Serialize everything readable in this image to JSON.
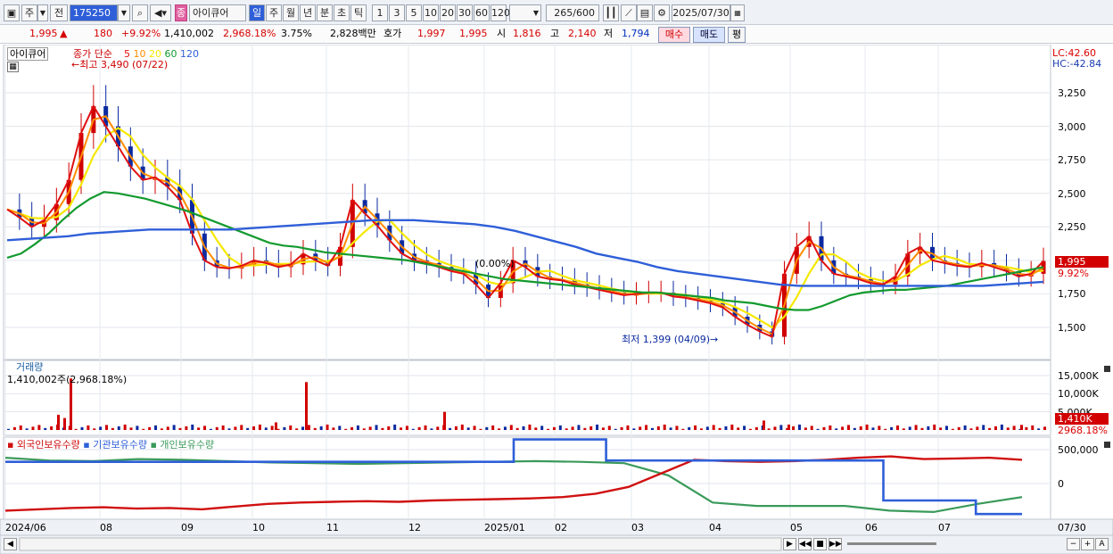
{
  "toolbar": {
    "window_icon": "window-icon",
    "market_select": "주",
    "prev_label": "전",
    "code": "175250",
    "name_badge": "종",
    "stock_name": "아이큐어",
    "periods": [
      "일",
      "주",
      "월",
      "년",
      "분",
      "초",
      "틱"
    ],
    "active_period": "일",
    "intervals": [
      "1",
      "3",
      "5",
      "10",
      "20",
      "30",
      "60",
      "120"
    ],
    "count": "265",
    "count_max": "/600",
    "date": "2025/07/30"
  },
  "quote": {
    "price": "1,995",
    "arrow": "▲",
    "change": "180",
    "change_pct": "+9.92%",
    "volume": "1,410,002",
    "volume_ratio": "2,968.18%",
    "turnover": "3.75%",
    "amount": "2,828백만",
    "hoga_label": "호가",
    "ask": "1,997",
    "bid": "1,995",
    "open_label": "시",
    "open": "1,816",
    "high_label": "고",
    "high": "2,140",
    "low_label": "저",
    "low": "1,794",
    "buy_label": "매수",
    "sell_label": "매도",
    "eval_label": "평"
  },
  "main_panel": {
    "stock_tag": "아이큐어",
    "legend_title": "종가 단순",
    "ma_periods": [
      "5",
      "10",
      "20",
      "60",
      "120"
    ],
    "ma_colors": [
      "#e01010",
      "#ff8c00",
      "#f5e800",
      "#139a2e",
      "#2f5fd8"
    ],
    "lc_label": "LC:42.60",
    "hc_label": "HC:-42.84",
    "high_note": "최고 3,490 (07/22)",
    "low_note": "최저 1,399 (04/09)",
    "mid_note": "(0.00%)",
    "price_ticks": [
      "3,250",
      "3,000",
      "2,750",
      "2,500",
      "2,250",
      "2,000",
      "1,750",
      "1,500"
    ],
    "current_price_tag": "1,995",
    "current_change_tag": "9.92%"
  },
  "volume_panel": {
    "title": "거래량",
    "current": "1,410,002주(2,968.18%)",
    "ticks": [
      "15,000K",
      "10,000K",
      "5,000K"
    ],
    "current_tag": "1,410K",
    "ratio_tag": "2968.18%"
  },
  "holding_panel": {
    "legends": [
      "외국인보유수량",
      "기관보유수량",
      "개인보유수량"
    ],
    "legend_colors": [
      "#d01010",
      "#2f5fd8",
      "#3a9a5a"
    ],
    "ticks": [
      "500,000",
      "0"
    ]
  },
  "x_axis": {
    "labels": [
      "2024/06",
      "08",
      "09",
      "10",
      "11",
      "12",
      "2025/01",
      "02",
      "03",
      "04",
      "05",
      "06",
      "07"
    ],
    "end_label": "07/30"
  },
  "bottom": {
    "nav_buttons": [
      "▶",
      "◀◀",
      "■",
      "▶▶"
    ],
    "zoom_buttons": [
      "−",
      "+",
      "A"
    ]
  },
  "chart_data": {
    "type": "candlestick",
    "first_date": "2024/06",
    "last_date": "2025/07/30",
    "price_axis_ticks": [
      3250,
      3000,
      2750,
      2500,
      2250,
      2000,
      1750,
      1500
    ],
    "high": {
      "value": 3490,
      "date": "07/22"
    },
    "low": {
      "value": 1399,
      "date": "04/09"
    },
    "last_close": 1995,
    "close_series": [
      2380,
      2320,
      2250,
      2300,
      2420,
      2600,
      2950,
      3150,
      3000,
      2850,
      2700,
      2600,
      2620,
      2550,
      2450,
      2200,
      2000,
      1950,
      1940,
      1960,
      2000,
      1980,
      1950,
      1970,
      2050,
      2000,
      1960,
      2100,
      2450,
      2350,
      2260,
      2150,
      2050,
      2000,
      1980,
      1950,
      1920,
      1900,
      1820,
      1720,
      1830,
      2000,
      1950,
      1880,
      1860,
      1850,
      1820,
      1800,
      1780,
      1760,
      1740,
      1750,
      1760,
      1760,
      1730,
      1720,
      1700,
      1680,
      1650,
      1580,
      1520,
      1470,
      1430,
      1900,
      2100,
      2180,
      2000,
      1900,
      1880,
      1860,
      1830,
      1820,
      1880,
      2050,
      2100,
      2000,
      1980,
      1960,
      1950,
      1980,
      1950,
      1920,
      1880,
      1900,
      1995
    ],
    "ma60_series": [
      2020,
      2050,
      2120,
      2200,
      2300,
      2390,
      2460,
      2510,
      2500,
      2480,
      2460,
      2430,
      2400,
      2370,
      2330,
      2290,
      2250,
      2210,
      2170,
      2130,
      2110,
      2100,
      2080,
      2060,
      2050,
      2040,
      2030,
      2020,
      2010,
      2000,
      1980,
      1960,
      1940,
      1920,
      1900,
      1880,
      1860,
      1850,
      1840,
      1830,
      1820,
      1810,
      1800,
      1790,
      1780,
      1770,
      1760,
      1760,
      1750,
      1740,
      1730,
      1720,
      1700,
      1690,
      1680,
      1660,
      1640,
      1630,
      1630,
      1660,
      1700,
      1740,
      1760,
      1770,
      1780,
      1780,
      1790,
      1800,
      1810,
      1830,
      1850,
      1870,
      1890,
      1910,
      1930,
      1950
    ],
    "ma120_series": [
      2150,
      2160,
      2170,
      2180,
      2200,
      2210,
      2220,
      2230,
      2230,
      2230,
      2230,
      2230,
      2240,
      2250,
      2260,
      2270,
      2280,
      2290,
      2300,
      2300,
      2300,
      2290,
      2280,
      2270,
      2250,
      2220,
      2180,
      2140,
      2100,
      2050,
      2020,
      1990,
      1950,
      1920,
      1900,
      1880,
      1860,
      1840,
      1820,
      1810,
      1810,
      1810,
      1810,
      1810,
      1810,
      1810,
      1810,
      1810,
      1810,
      1820,
      1830,
      1840
    ],
    "volume_spikes": [
      {
        "date": "07/22",
        "value": 14200000
      },
      {
        "date": "10/24",
        "value": 13200000
      },
      {
        "date": "12/10",
        "value": 5000000
      },
      {
        "date": "2025/07/30",
        "value": 1410002
      }
    ],
    "foreign_holding_series": [
      -400000,
      -380000,
      -360000,
      -350000,
      -370000,
      -360000,
      -380000,
      -340000,
      -300000,
      -280000,
      -270000,
      -260000,
      -270000,
      -250000,
      -240000,
      -230000,
      -220000,
      -200000,
      -150000,
      -50000,
      150000,
      350000,
      330000,
      320000,
      330000,
      350000,
      380000,
      400000,
      360000,
      370000,
      380000,
      350000
    ],
    "institution_holding_series": [
      320000,
      320000,
      320000,
      320000,
      320000,
      320000,
      320000,
      320000,
      320000,
      320000,
      320000,
      650000,
      650000,
      340000,
      340000,
      340000,
      340000,
      340000,
      340000,
      -250000,
      -250000,
      -450000,
      -450000
    ],
    "individual_holding_series": [
      380000,
      340000,
      330000,
      360000,
      350000,
      330000,
      310000,
      300000,
      290000,
      300000,
      310000,
      320000,
      330000,
      320000,
      300000,
      120000,
      -280000,
      -330000,
      -330000,
      -330000,
      -400000,
      -420000,
      -300000,
      -200000
    ]
  }
}
